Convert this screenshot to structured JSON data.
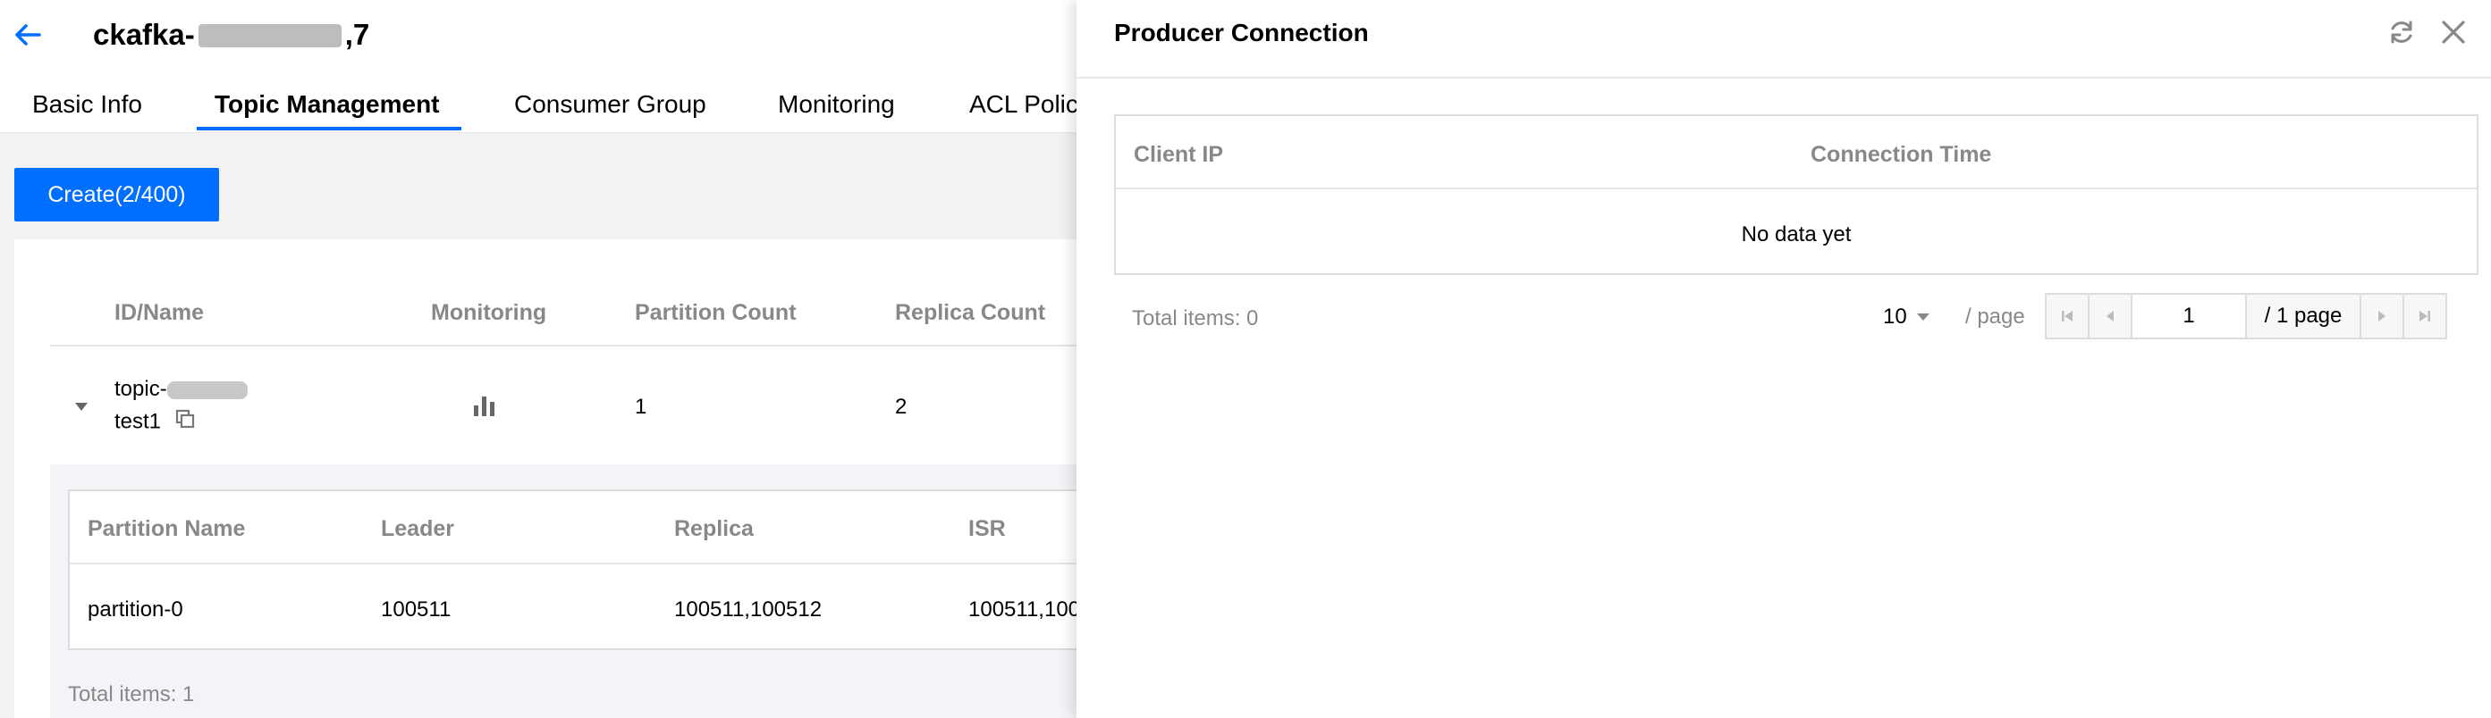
{
  "header": {
    "instance_title": "ckafka-",
    "instance_title_tail": ",7"
  },
  "tabs": [
    {
      "label": "Basic Info"
    },
    {
      "label": "Topic Management"
    },
    {
      "label": "Consumer Group"
    },
    {
      "label": "Monitoring"
    },
    {
      "label": "ACL Polic"
    }
  ],
  "toolbar": {
    "create_label": "Create(2/400)"
  },
  "topic_table": {
    "columns": [
      "ID/Name",
      "Monitoring",
      "Partition Count",
      "Replica Count"
    ],
    "rows": [
      {
        "id_prefix": "topic-",
        "name": "test1",
        "partition_count": "1",
        "replica_count": "2"
      }
    ]
  },
  "partition_table": {
    "columns": [
      "Partition Name",
      "Leader",
      "Replica",
      "ISR"
    ],
    "rows": [
      {
        "name": "partition-0",
        "leader": "100511",
        "replica": "100511,100512",
        "isr": "100511,100"
      }
    ],
    "total": "Total items:  1"
  },
  "drawer": {
    "title": "Producer Connection",
    "columns": [
      "Client IP",
      "Connection Time"
    ],
    "empty_text": "No data yet",
    "total": "Total items:  0",
    "page_size": "10",
    "per_page_label": "/ page",
    "current_page": "1",
    "page_count_label": "/ 1 page"
  },
  "colors": {
    "accent": "#006eff",
    "header_text_gray": "#888888",
    "border": "#dcdcdc"
  }
}
